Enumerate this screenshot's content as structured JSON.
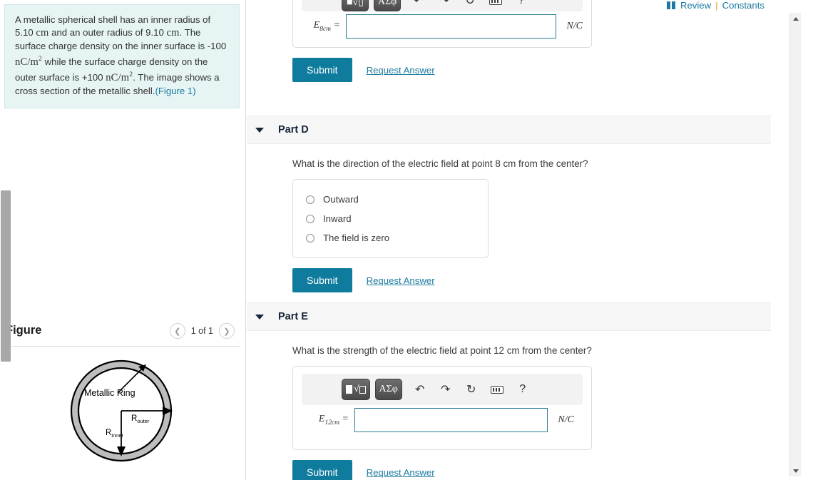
{
  "header": {
    "review_label": "Review",
    "separator": "|",
    "constants_label": "Constants",
    "book_icon": "book-icon"
  },
  "problem": {
    "text_1": "A metallic spherical shell has an inner radius of 5.10",
    "unit_1": "cm",
    "text_2": "and an outer radius of 9.10",
    "unit_2": "cm",
    "text_3": ". The surface charge density on the inner surface is -100",
    "unit_3": "nC/m",
    "exp_3": "2",
    "text_4": "while the surface charge density on the outer surface is +100",
    "unit_4": "nC/m",
    "exp_4": "2",
    "text_5": ". The image shows a cross section of the metallic shell.",
    "figure_link": "(Figure 1)"
  },
  "figure": {
    "title": "Figure",
    "prev_icon": "chevron-left-icon",
    "next_icon": "chevron-right-icon",
    "count_label": "1 of 1",
    "diagram": {
      "ring_label": "Metallic Ring",
      "outer_label": "R",
      "outer_sub": "outer",
      "inner_label": "R",
      "inner_sub": "inner"
    }
  },
  "top_partial": {
    "eq_label": "E",
    "eq_sub": "8cm",
    "eq_equals": "=",
    "unit": "N/C",
    "input_value": "",
    "submit_label": "Submit",
    "request_label": "Request Answer",
    "toolbar": {
      "template_label": "■√▯",
      "greek_label": "ΑΣφ",
      "undo_icon": "undo-icon",
      "redo_icon": "redo-icon",
      "reset_icon": "reset-icon",
      "keyboard_icon": "keyboard-icon",
      "help_label": "?"
    }
  },
  "part_d": {
    "caret_icon": "caret-down-icon",
    "label": "Part D",
    "question": "What is the direction of the electric field at point 8 cm from the center?",
    "options": [
      {
        "label": "Outward",
        "selected": false
      },
      {
        "label": "Inward",
        "selected": false
      },
      {
        "label": "The field is zero",
        "selected": false
      }
    ],
    "submit_label": "Submit",
    "request_label": "Request Answer"
  },
  "part_e": {
    "caret_icon": "caret-down-icon",
    "label": "Part E",
    "question": "What is the strength of the electric field at point 12 cm from the center?",
    "toolbar": {
      "template_label": "√",
      "greek_label": "ΑΣφ",
      "undo_icon": "undo-icon",
      "redo_icon": "redo-icon",
      "reset_icon": "reset-icon",
      "keyboard_icon": "keyboard-icon",
      "help_label": "?"
    },
    "eq_label": "E",
    "eq_sub": "12cm",
    "eq_equals": "=",
    "input_value": "",
    "unit": "N/C",
    "submit_label": "Submit",
    "request_label": "Request Answer"
  },
  "scrollbar": {
    "up_icon": "scroll-up-icon",
    "down_icon": "scroll-down-icon",
    "thumb": "scroll-thumb"
  },
  "colors": {
    "accent_teal": "#0f7c9e",
    "link_teal": "#1c7ba0",
    "problem_bg": "#e6f4f4",
    "part_header_bg": "#f7f7f7",
    "input_border": "#2b7a94",
    "ring_fill": "#bdbdbd"
  }
}
